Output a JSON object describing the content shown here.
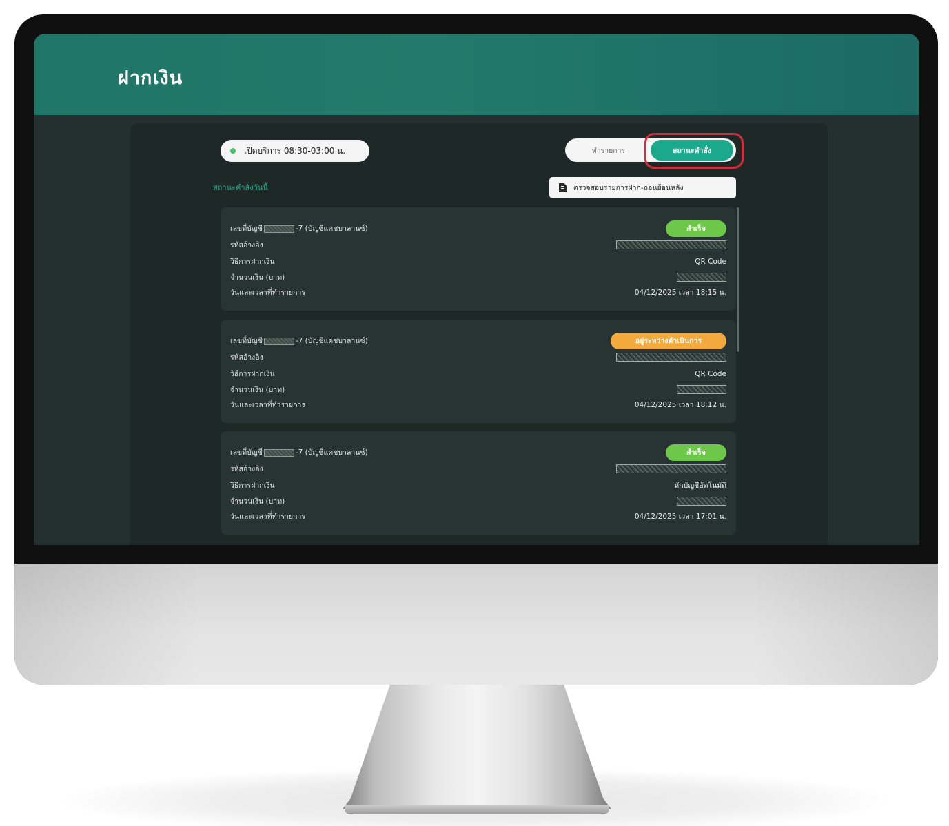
{
  "header": {
    "title": "ฝากเงิน"
  },
  "service_hours": "เปิดบริการ 08:30-03:00 น.",
  "tabs": [
    {
      "label": "ทำรายการ",
      "active": false
    },
    {
      "label": "สถานะคำสั่ง",
      "active": true
    }
  ],
  "section_title": "สถานะคำสั่งวันนี้",
  "history_button": "ตรวจสอบรายการฝาก-ถอนย้อนหลัง",
  "labels": {
    "account": "เลขที่บัญชี",
    "ref": "รหัสอ้างอิง",
    "method": "วิธีการฝากเงิน",
    "amount": "จำนวนเงิน (บาท)",
    "datetime": "วันและเวลาที่ทำรายการ"
  },
  "transactions": [
    {
      "account_suffix": "-7 (บัญชีแคชบาลานซ์)",
      "status": "สำเร็จ",
      "method": "QR Code",
      "datetime": "04/12/2025 เวลา 18:15 น."
    },
    {
      "account_suffix": "-7 (บัญชีแคชบาลานซ์)",
      "status": "อยู่ระหว่างดำเนินการ",
      "method": "QR Code",
      "datetime": "04/12/2025 เวลา 18:12 น."
    },
    {
      "account_suffix": "-7 (บัญชีแคชบาลานซ์)",
      "status": "สำเร็จ",
      "method": "หักบัญชีอัตโนมัติ",
      "datetime": "04/12/2025 เวลา 17:01 น."
    }
  ],
  "colors": {
    "header": "#1f7567",
    "accent": "#1aaa8b",
    "success": "#6dc849",
    "pending": "#f2a93e",
    "highlight": "#d42c3c"
  },
  "icons": [
    "document-icon",
    "status-dot-icon"
  ]
}
